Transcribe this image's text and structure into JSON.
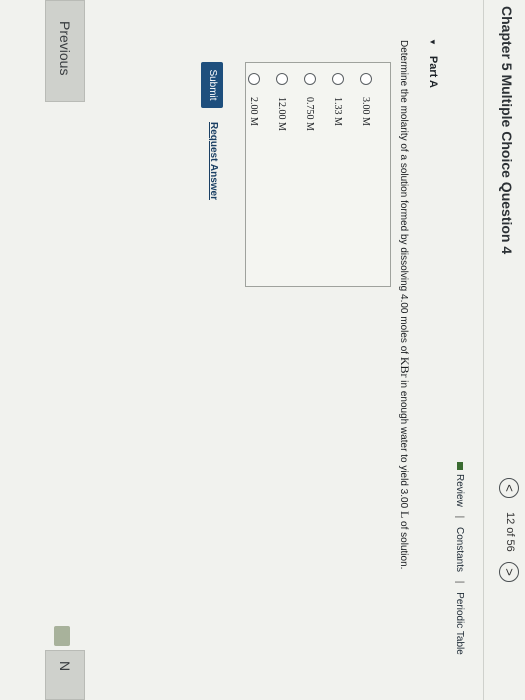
{
  "header": {
    "title": "Chapter 5 Multiple Choice Question 4",
    "prev_symbol": "<",
    "counter": "12 of 56",
    "next_symbol": ">"
  },
  "links": {
    "review": "Review",
    "separator": "|",
    "constants": "Constants",
    "periodic_table": "Periodic Table"
  },
  "part": {
    "label": "Part A",
    "toggle_symbol": "▼"
  },
  "question": {
    "text_before": "Determine the molarity of a solution formed by dissolving 4.00 moles of ",
    "compound": "KBr",
    "text_middle": " in enough water to yield 3.00 ",
    "unit": "L",
    "text_after": " of solution."
  },
  "choices": [
    {
      "label": "3.00 M"
    },
    {
      "label": "1.33 M"
    },
    {
      "label": "0.750 M"
    },
    {
      "label": "12.00 M"
    },
    {
      "label": "2.00 M"
    }
  ],
  "actions": {
    "submit": "Submit",
    "request_answer": "Request Answer"
  },
  "footer": {
    "previous": "Previous",
    "next": "N"
  },
  "colors": {
    "submit_bg": "#1e4f7d",
    "link": "#1a3f63",
    "review_icon": "#3a6b31"
  }
}
